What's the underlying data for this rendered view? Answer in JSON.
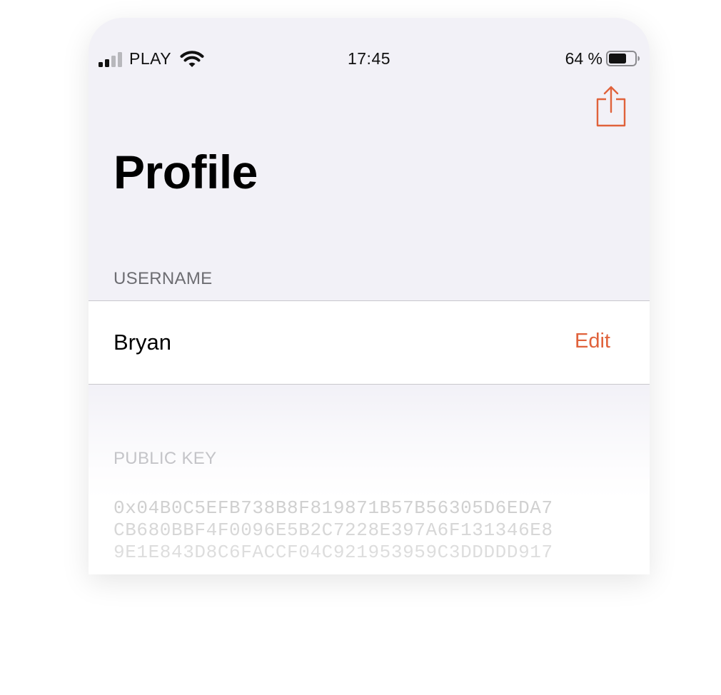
{
  "status_bar": {
    "carrier": "PLAY",
    "time": "17:45",
    "battery": "64 %"
  },
  "nav": {
    "share_icon": "share-icon",
    "title": "Profile"
  },
  "sections": {
    "username": {
      "header": "USERNAME",
      "value": "Bryan",
      "action": "Edit"
    },
    "public_key": {
      "header": "PUBLIC KEY",
      "lines": [
        "0x04B0C5EFB738B8F819871B57B56305D6EDA7",
        "CB680BBF4F0096E5B2C7228E397A6F131346E8",
        "9E1E843D8C6FACCF04C921953959C3DDDDD917"
      ]
    }
  },
  "colors": {
    "accent": "#e0623b",
    "background": "#f2f1f7",
    "cell": "#ffffff",
    "section_header": "#6d6d72"
  }
}
